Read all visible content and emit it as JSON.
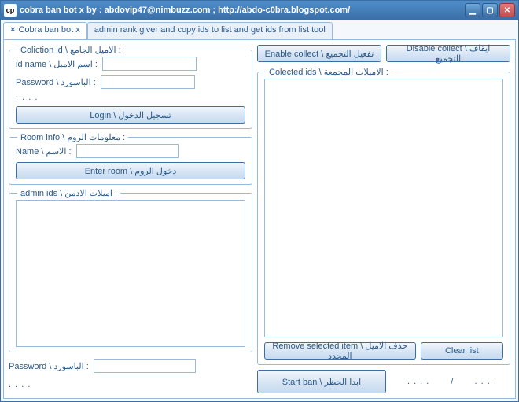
{
  "window": {
    "title": "cobra ban bot x by : abdovip47@nimbuzz.com   ; http://abdo-c0bra.blogspot.com/",
    "app_icon": "cp"
  },
  "tabs": {
    "tab1": "Cobra ban bot x",
    "tab2": "admin rank giver and copy ids to list and get ids from list tool"
  },
  "coliction_group": {
    "title": "Coliction id \\ الاميل الجامع :",
    "id_label": "id name \\ اسم الاميل :",
    "pw_label": "Password \\ الباسورد :",
    "dots": ". . . .",
    "login_btn": "Login \\ تسجيل الدخول"
  },
  "room_group": {
    "title": "Room info \\ معلومات الروم :",
    "name_label": "Name \\ الاسم :",
    "enter_btn": "Enter room \\ دخول الروم"
  },
  "admin_group": {
    "title": "admin ids \\ اميلات الادمن :"
  },
  "pw2": {
    "label": "Password \\ الباسورد :",
    "dots": ". . . ."
  },
  "right": {
    "enable_btn": "Enable collect \\ تفعيل التجميع",
    "disable_btn": "Disable collect \\ ايقاف التجميع",
    "collected_title": "Colected ids \\ الاميلات المجمعة :",
    "remove_btn": "Remove selected item \\ حذف الاميل المحدد",
    "clear_btn": "Clear list",
    "start_btn": "Start ban \\ ابدا الحظر",
    "dots": ". . . .",
    "sep": "/"
  }
}
